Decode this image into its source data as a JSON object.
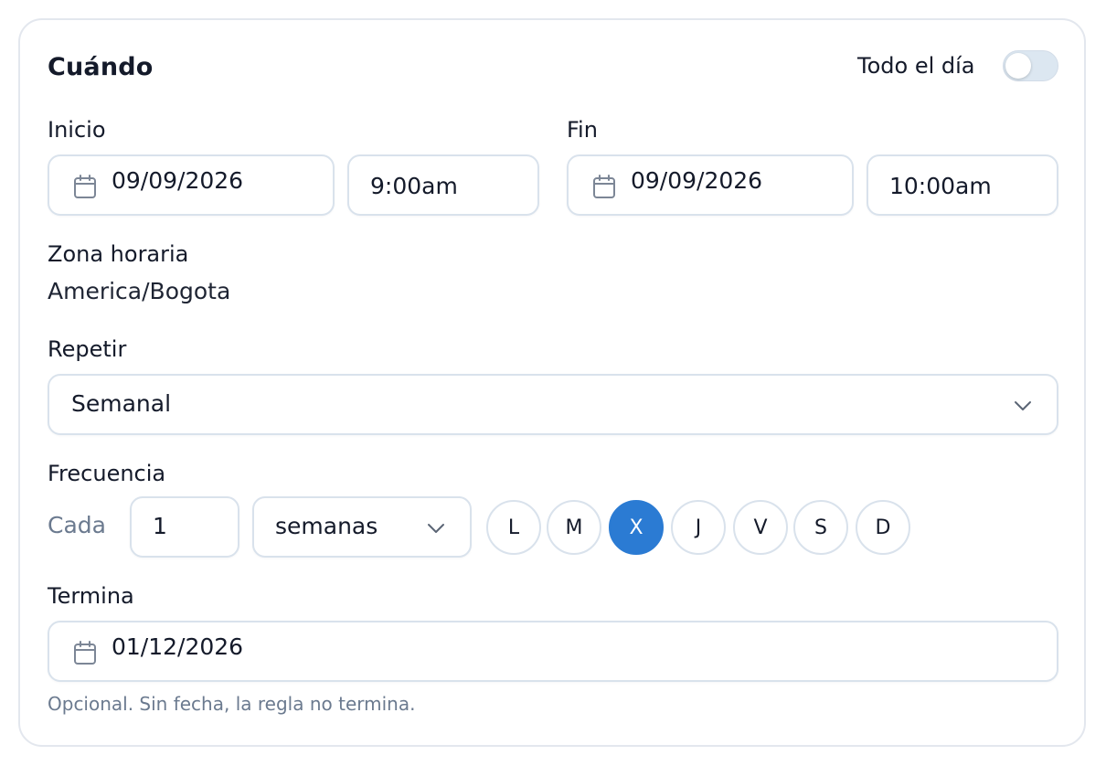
{
  "section": {
    "title": "Cuándo",
    "all_day": {
      "label": "Todo el día",
      "enabled": false
    }
  },
  "start": {
    "label": "Inicio",
    "date": "09/09/2026",
    "time": "9:00am"
  },
  "end": {
    "label": "Fin",
    "date": "09/09/2026",
    "time": "10:00am"
  },
  "timezone": {
    "label": "Zona horaria",
    "value": "America/Bogota"
  },
  "repeat": {
    "label": "Repetir",
    "selected": "Semanal"
  },
  "frequency": {
    "label": "Frecuencia",
    "every_label": "Cada",
    "interval": "1",
    "unit": "semanas",
    "days": [
      {
        "label": "L",
        "selected": false
      },
      {
        "label": "M",
        "selected": false
      },
      {
        "label": "X",
        "selected": true
      },
      {
        "label": "J",
        "selected": false
      },
      {
        "label": "V",
        "selected": false
      },
      {
        "label": "S",
        "selected": false
      },
      {
        "label": "D",
        "selected": false
      }
    ],
    "selected_color": "#2b7bd3"
  },
  "ends": {
    "label": "Termina",
    "date": "01/12/2026",
    "hint": "Opcional. Sin fecha, la regla no termina."
  },
  "icons": {
    "date": "calendar-icon",
    "dropdown": "chevron-down-icon"
  }
}
